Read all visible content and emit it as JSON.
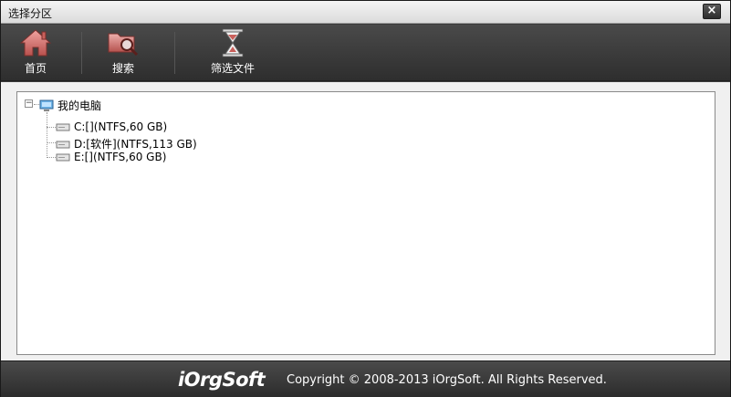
{
  "window": {
    "title": "选择分区",
    "close_glyph": "×"
  },
  "toolbar": {
    "items": [
      {
        "label": "首页",
        "icon": "home-icon"
      },
      {
        "label": "搜索",
        "icon": "folder-search-icon"
      },
      {
        "label": "筛选文件",
        "icon": "hourglass-icon"
      }
    ]
  },
  "tree": {
    "expander": "−",
    "root": {
      "label": "我的电脑",
      "icon": "computer-icon"
    },
    "drives": [
      {
        "label": "C:[](NTFS,60 GB)",
        "icon": "drive-icon"
      },
      {
        "label": "D:[软件](NTFS,113 GB)",
        "icon": "drive-icon"
      },
      {
        "label": "E:[](NTFS,60 GB)",
        "icon": "drive-icon"
      }
    ]
  },
  "footer": {
    "logo": "iOrgSoft",
    "copyright": "Copyright © 2008-2013 iOrgSoft. All Rights Reserved."
  }
}
